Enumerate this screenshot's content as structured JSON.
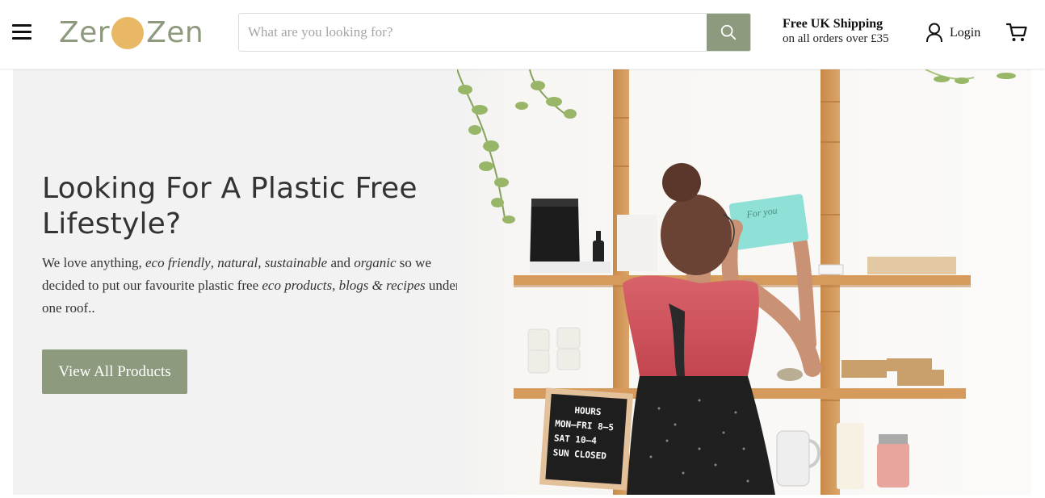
{
  "header": {
    "menu_icon": "hamburger-menu-icon",
    "logo": {
      "word1": "Zer",
      "word2": "Zen",
      "dot_color": "#e8b865",
      "text_color": "#8d9a7e"
    },
    "search": {
      "placeholder": "What are you looking for?",
      "value": "",
      "icon": "search-icon"
    },
    "shipping": {
      "title": "Free UK Shipping",
      "subtitle": "on all orders over £35"
    },
    "login": {
      "label": "Login",
      "icon": "user-icon"
    },
    "cart": {
      "icon": "cart-icon"
    }
  },
  "hero": {
    "title": "Looking For A Plastic Free Lifestyle?",
    "text_parts": {
      "p1": "We love anything, ",
      "e1": "eco friendly",
      "p2": ", ",
      "e2": "natural",
      "p3": ", ",
      "e3": "sustainable",
      "p4": " and ",
      "e4": "organic",
      "p5": " so we decided to put our favourite plastic free ",
      "e5": "eco products, blogs & recipes",
      "p6": " under one roof.."
    },
    "button_label": "View All Products",
    "image": {
      "letter_board": [
        "HOURS",
        "MON–FRI 8–5",
        "SAT   10–4",
        "SUN   CLOSED"
      ],
      "gift_box_text": "For you"
    }
  },
  "colors": {
    "accent": "#8d9a7e",
    "hero_bg": "#f2f2f2",
    "logo_dot": "#e8b865"
  }
}
